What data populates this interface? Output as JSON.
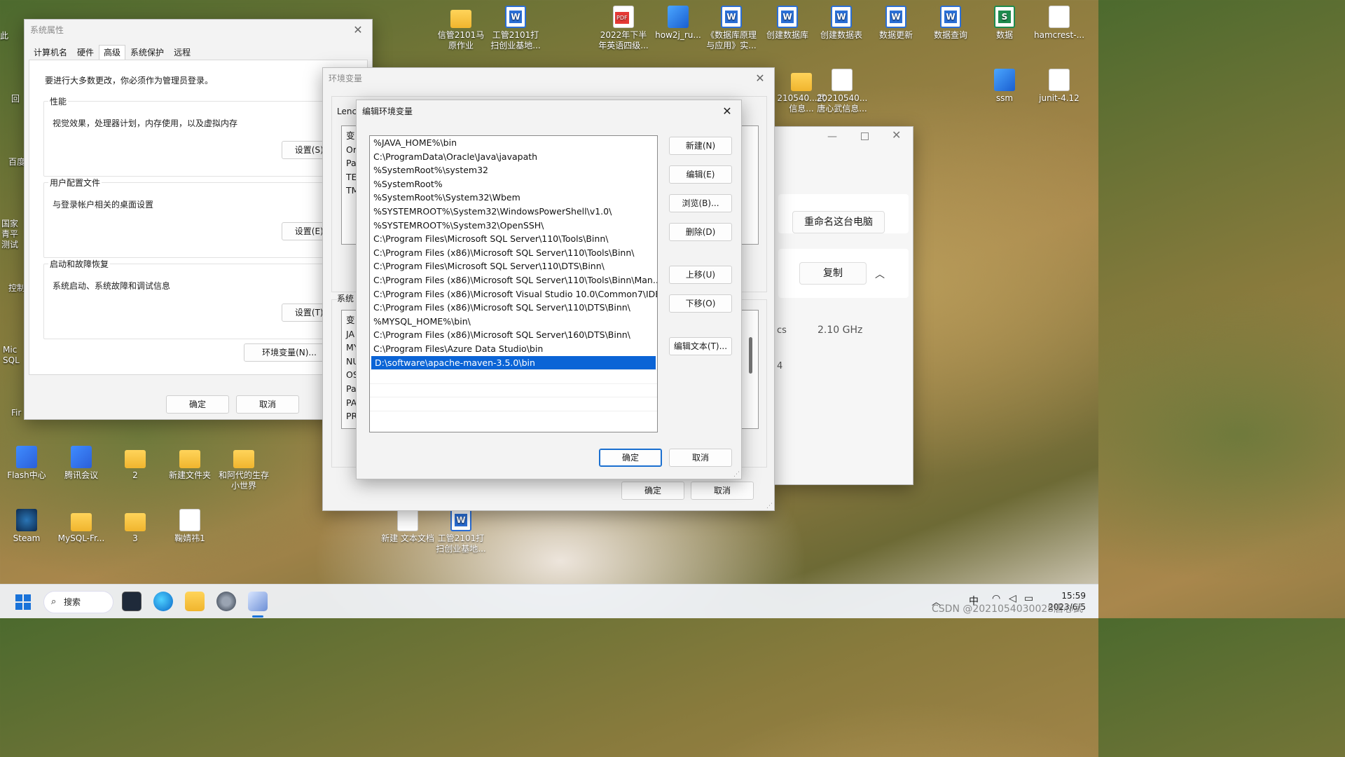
{
  "desktop_icons": {
    "top_row": [
      {
        "label": "信管2101马原作业"
      },
      {
        "label": "工管2101打扫创业基地..."
      },
      {
        "label": "2022年下半年英语四级..."
      },
      {
        "label": "how2j_ru..."
      },
      {
        "label": "《数据库原理与应用》实..."
      },
      {
        "label": "创建数据库"
      },
      {
        "label": "创建数据表"
      },
      {
        "label": "数据更新"
      },
      {
        "label": "数据查询"
      },
      {
        "label": "数据"
      },
      {
        "label": "hamcrest-..."
      }
    ],
    "second_row": [
      {
        "label": "210540...武信息..."
      },
      {
        "label": "20210540...唐心武信息..."
      },
      {
        "label": "ssm"
      },
      {
        "label": "junit-4.12"
      }
    ],
    "left_partial": [
      "此",
      "回",
      "百度",
      "国家青平测试",
      "控制",
      "Mic SQL",
      "Fir"
    ],
    "bottom_row1": [
      {
        "label": "Flash中心"
      },
      {
        "label": "腾讯会议"
      },
      {
        "label": "2"
      },
      {
        "label": "新建文件夹"
      },
      {
        "label": "和阿代的生存小世界"
      }
    ],
    "bottom_row2": [
      {
        "label": "Steam"
      },
      {
        "label": "MySQL-Fr..."
      },
      {
        "label": "3"
      },
      {
        "label": "鞠婧祎1"
      },
      {
        "label": "新建 文本文档"
      },
      {
        "label": "工管2101打扫创业基地..."
      }
    ]
  },
  "system_properties": {
    "title": "系统属性",
    "tabs": [
      "计算机名",
      "硬件",
      "高级",
      "系统保护",
      "远程"
    ],
    "active_tab": "高级",
    "admin_note": "要进行大多数更改，你必须作为管理员登录。",
    "performance": {
      "title": "性能",
      "desc": "视觉效果，处理器计划，内存使用，以及虚拟内存",
      "button": "设置(S)..."
    },
    "user_profile": {
      "title": "用户配置文件",
      "desc": "与登录帐户相关的桌面设置",
      "button": "设置(E)..."
    },
    "startup": {
      "title": "启动和故障恢复",
      "desc": "系统启动、系统故障和调试信息",
      "button": "设置(T)..."
    },
    "env_button": "环境变量(N)...",
    "ok": "确定",
    "cancel": "取消"
  },
  "env_vars": {
    "title": "环境变量",
    "user_section_partial": "Lenc",
    "user_list_partial": [
      "变",
      "Or",
      "Pa",
      "TE",
      "TM"
    ],
    "system_section_partial": "系统",
    "system_list_partial": [
      "变",
      "JA",
      "MY",
      "NU",
      "OS",
      "Pa",
      "PA",
      "PR"
    ],
    "ok": "确定",
    "cancel": "取消"
  },
  "edit_env": {
    "title": "编辑环境变量",
    "entries": [
      "%JAVA_HOME%\\bin",
      "C:\\ProgramData\\Oracle\\Java\\javapath",
      "%SystemRoot%\\system32",
      "%SystemRoot%",
      "%SystemRoot%\\System32\\Wbem",
      "%SYSTEMROOT%\\System32\\WindowsPowerShell\\v1.0\\",
      "%SYSTEMROOT%\\System32\\OpenSSH\\",
      "C:\\Program Files\\Microsoft SQL Server\\110\\Tools\\Binn\\",
      "C:\\Program Files (x86)\\Microsoft SQL Server\\110\\Tools\\Binn\\",
      "C:\\Program Files\\Microsoft SQL Server\\110\\DTS\\Binn\\",
      "C:\\Program Files (x86)\\Microsoft SQL Server\\110\\Tools\\Binn\\Man...",
      "C:\\Program Files (x86)\\Microsoft Visual Studio 10.0\\Common7\\IDE...",
      "C:\\Program Files (x86)\\Microsoft SQL Server\\110\\DTS\\Binn\\",
      "%MYSQL_HOME%\\bin\\",
      "C:\\Program Files (x86)\\Microsoft SQL Server\\160\\DTS\\Binn\\",
      "C:\\Program Files\\Azure Data Studio\\bin",
      "D:\\software\\apache-maven-3.5.0\\bin"
    ],
    "selected_index": 16,
    "buttons": {
      "new": "新建(N)",
      "edit": "编辑(E)",
      "browse": "浏览(B)...",
      "delete": "删除(D)",
      "move_up": "上移(U)",
      "move_down": "下移(O)",
      "edit_text": "编辑文本(T)..."
    },
    "ok": "确定",
    "cancel": "取消"
  },
  "about_window": {
    "rename_button": "重命名这台电脑",
    "copy_button": "复制",
    "spec_partial": "cs",
    "spec_value": "2.10 GHz",
    "spec_partial2": "4"
  },
  "taskbar": {
    "search": "搜索",
    "ime": "中",
    "time": "15:59",
    "date": "2023/6/5"
  },
  "watermark": "CSDN @2021054030028唐心武"
}
